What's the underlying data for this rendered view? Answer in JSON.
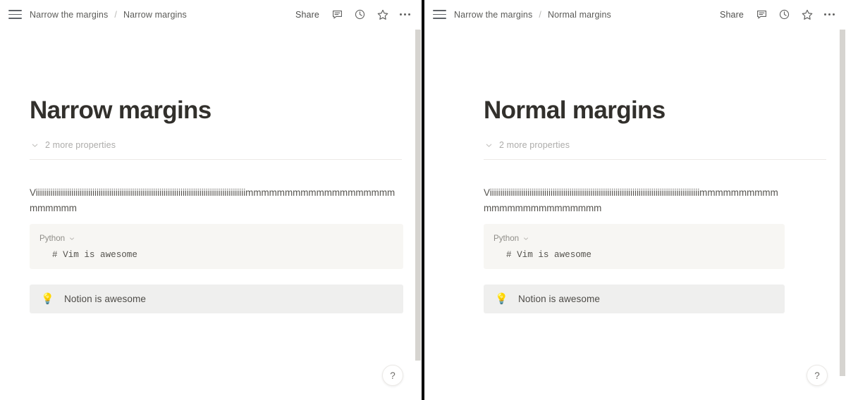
{
  "panels": [
    {
      "id": "left",
      "topbar": {
        "menu_icon": "hamburger-menu-icon",
        "breadcrumb": {
          "parent": "Narrow the margins",
          "separator": "/",
          "current": "Narrow margins"
        },
        "share_label": "Share",
        "icons": [
          "comment-icon",
          "history-clock-icon",
          "star-icon",
          "more-options-icon"
        ]
      },
      "doc": {
        "title": "Narrow margins",
        "properties_toggle": "2 more properties",
        "paragraph": "Viiiiiiiiiiiiiiiiiiiiiiiiiiiiiiiiiiiiiiiiiiiiiiiiiiiiiiiiiiiiiiiiiiiiiiiiiiiiiiiiiiiiiiiiiiiiiiiiiiiimmmmmmmmmmmmmmmmmmmmmmmmm",
        "code": {
          "language": "Python",
          "content": "# Vim is awesome"
        },
        "callout": {
          "emoji": "💡",
          "text": "Notion is awesome"
        }
      },
      "help_label": "?"
    },
    {
      "id": "right",
      "topbar": {
        "menu_icon": "hamburger-menu-icon",
        "breadcrumb": {
          "parent": "Narrow the margins",
          "separator": "/",
          "current": "Normal margins"
        },
        "share_label": "Share",
        "icons": [
          "comment-icon",
          "history-clock-icon",
          "star-icon",
          "more-options-icon"
        ]
      },
      "doc": {
        "title": "Normal margins",
        "properties_toggle": "2 more properties",
        "paragraph": "Viiiiiiiiiiiiiiiiiiiiiiiiiiiiiiiiiiiiiiiiiiiiiiiiiiiiiiiiiiiiiiiiiiiiiiiiiiiiiiiiiiiiiiiiiiiiiiiiiiiimmmmmmmmmmmmmmmmmmmmmmmmm",
        "code": {
          "language": "Python",
          "content": "# Vim is awesome"
        },
        "callout": {
          "emoji": "💡",
          "text": "Notion is awesome"
        }
      },
      "help_label": "?"
    }
  ],
  "colors": {
    "page_background": "#ffffff",
    "divider": "#000000",
    "title_text": "#32302c",
    "body_text": "#55534e",
    "muted_text": "#adacaa",
    "code_background": "#f7f6f3",
    "callout_background": "#efefee",
    "scrollbar_thumb": "#d6d4d0"
  }
}
